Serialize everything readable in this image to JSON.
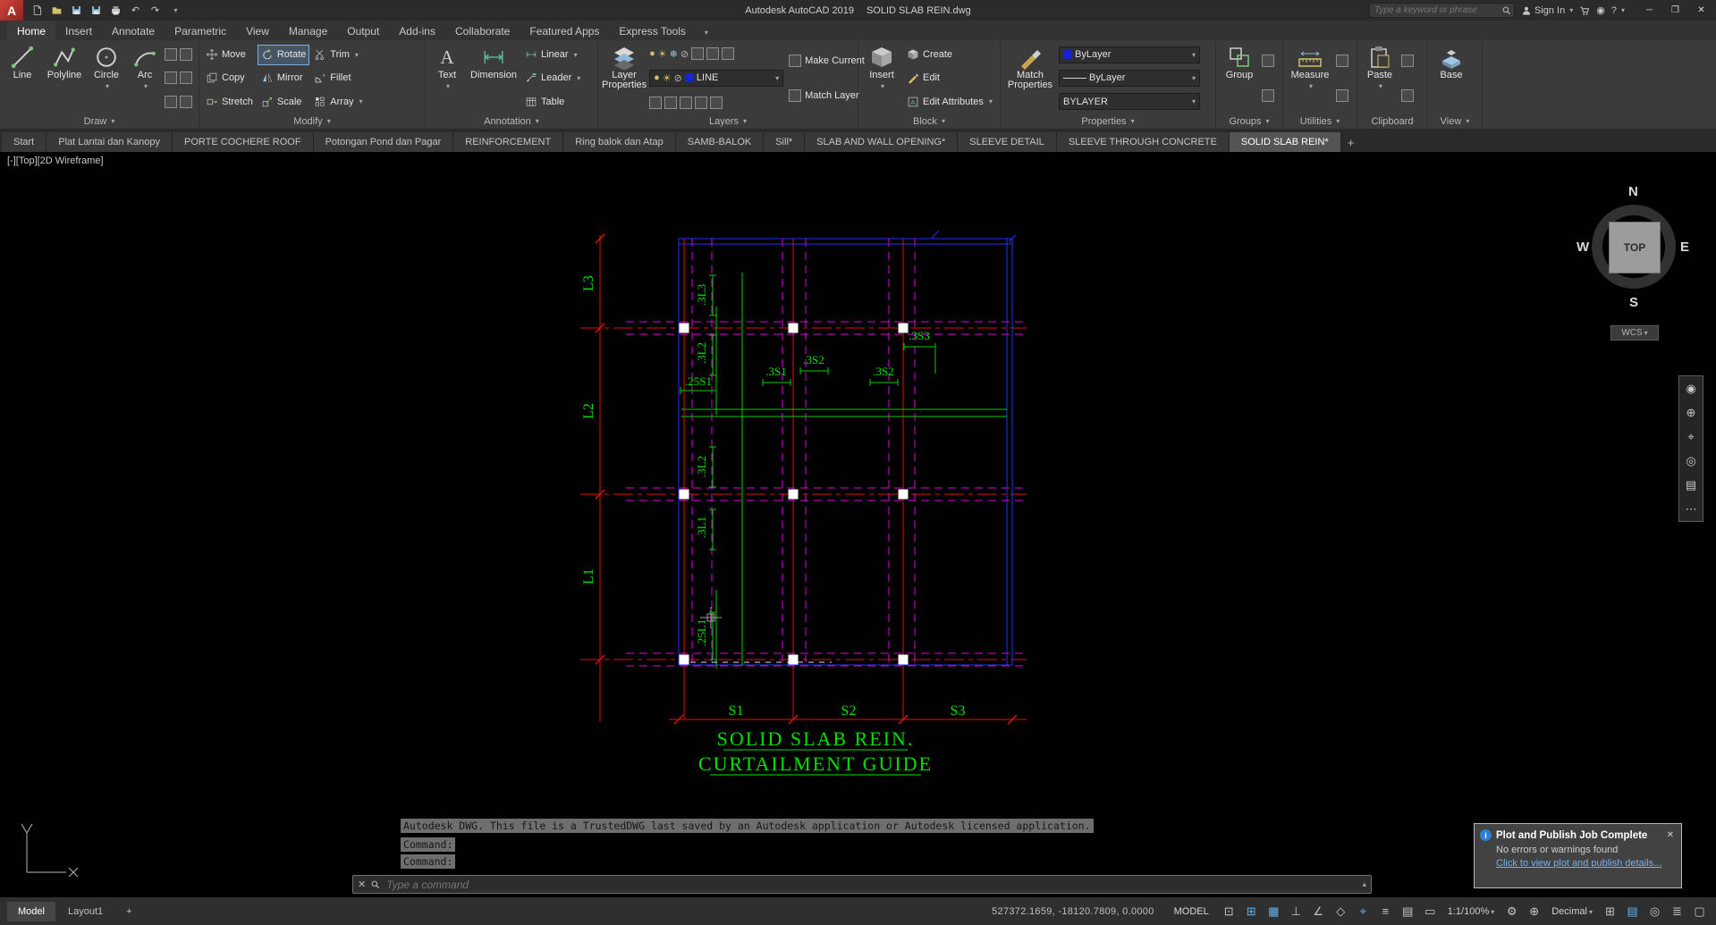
{
  "titlebar": {
    "app_title": "Autodesk AutoCAD 2019",
    "doc_title": "SOLID SLAB REIN.dwg",
    "search_placeholder": "Type a keyword or phrase",
    "sign_in_label": "Sign In"
  },
  "ribbon_tabs": {
    "items": [
      "Home",
      "Insert",
      "Annotate",
      "Parametric",
      "View",
      "Manage",
      "Output",
      "Add-ins",
      "Collaborate",
      "Featured Apps",
      "Express Tools"
    ]
  },
  "ribbon": {
    "draw": {
      "label": "Draw",
      "line": "Line",
      "polyline": "Polyline",
      "circle": "Circle",
      "arc": "Arc"
    },
    "modify": {
      "label": "Modify",
      "move": "Move",
      "rotate": "Rotate",
      "trim": "Trim",
      "copy": "Copy",
      "mirror": "Mirror",
      "fillet": "Fillet",
      "stretch": "Stretch",
      "scale": "Scale",
      "array": "Array"
    },
    "annotation": {
      "label": "Annotation",
      "text": "Text",
      "dimension": "Dimension",
      "linear": "Linear",
      "leader": "Leader",
      "table": "Table"
    },
    "layers": {
      "label": "Layers",
      "layer_properties": "Layer\nProperties",
      "current_layer": "LINE",
      "make_current": "Make Current",
      "match_layer": "Match Layer"
    },
    "block": {
      "label": "Block",
      "insert": "Insert",
      "create": "Create",
      "edit": "Edit",
      "edit_attributes": "Edit Attributes"
    },
    "properties": {
      "label": "Properties",
      "match_properties": "Match\nProperties",
      "color": "ByLayer",
      "linetype": "ByLayer",
      "lineweight": "BYLAYER"
    },
    "groups": {
      "label": "Groups",
      "group": "Group"
    },
    "utilities": {
      "label": "Utilities",
      "measure": "Measure"
    },
    "clipboard": {
      "label": "Clipboard",
      "paste": "Paste"
    },
    "view": {
      "label": "View",
      "base": "Base"
    }
  },
  "file_tabs": [
    "Start",
    "Plat Lantai dan Kanopy",
    "PORTE COCHERE ROOF",
    "Potongan Pond dan Pagar",
    "REINFORCEMENT",
    "Ring balok dan Atap",
    "SAMB-BALOK",
    "Sill*",
    "SLAB AND WALL OPENING*",
    "SLEEVE DETAIL",
    "SLEEVE THROUGH CONCRETE",
    "SOLID SLAB REIN*"
  ],
  "viewport": {
    "controls": "[-][Top][2D Wireframe]",
    "viewcube": {
      "n": "N",
      "e": "E",
      "s": "S",
      "w": "W",
      "face": "TOP",
      "wcs": "WCS"
    }
  },
  "drawing": {
    "row_labels": [
      "L3",
      "L2",
      "L1"
    ],
    "col_labels": [
      "S1",
      "S2",
      "S3"
    ],
    "ann": {
      "a1": ".3L3",
      "a2": ".3L2",
      "a3": ".25S1",
      "a4": ".3S1",
      "a5": ".3S2",
      "a6": ".3S2",
      "a7": ".3S3",
      "a8": ".3L2",
      "a9": ".3L1",
      "a10": ".25L1"
    },
    "title1": "SOLID SLAB REIN.",
    "title2": "CURTAILMENT GUIDE"
  },
  "command": {
    "trusted_line": "Autodesk DWG.  This file is a TrustedDWG last saved by an Autodesk application or Autodesk licensed application.",
    "prompt1": "Command:",
    "prompt2": "Command:",
    "placeholder": "Type a command"
  },
  "toast": {
    "title": "Plot and Publish Job Complete",
    "body": "No errors or warnings found",
    "link": "Click to view plot and publish details..."
  },
  "statusbar": {
    "model_tab": "Model",
    "layout_tab": "Layout1",
    "new_layout": "+",
    "coords": "527372.1659, -18120.7809, 0.0000",
    "space": "MODEL",
    "scale": "1:1/100%",
    "units": "Decimal"
  },
  "icons": {
    "undo": "↶",
    "redo": "↷",
    "min": "─",
    "max": "❐",
    "close": "✕",
    "x": "✕",
    "plus": "+",
    "grid": "▦",
    "snap": "⊞",
    "infer": "⊡",
    "ortho": "⊥",
    "polar": "∠",
    "isodraft": "◇",
    "osnap": "⌖",
    "lineweight": "≡",
    "transparency": "▤",
    "selection": "▭",
    "gear": "⚙",
    "annmonitor": "⊕",
    "isolate": "◎",
    "graphics": "≣",
    "cleanscreen": "▢",
    "plot": "▤",
    "caret_up": "▴",
    "nav_wheel": "◉",
    "nav_pan": "⊕",
    "nav_zoom": "⌖",
    "nav_orbit": "◎",
    "nav_motion": "▤",
    "nav_more": "⋯",
    "bulb": "●",
    "sun": "☀",
    "freeze": "❄",
    "lock": "⊘",
    "half": "◐",
    "walk": "▥",
    "bell": "◉",
    "cart": "▣",
    "help": "?"
  }
}
